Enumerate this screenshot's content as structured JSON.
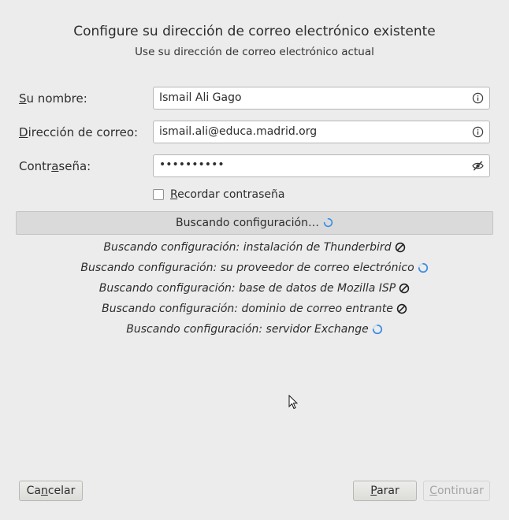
{
  "header": {
    "title": "Configure su dirección de correo electrónico existente",
    "subtitle": "Use su dirección de correo electrónico actual"
  },
  "form": {
    "name": {
      "label_pre": "",
      "label_key": "S",
      "label_post": "u nombre:",
      "value": "Ismail Ali Gago",
      "icon": "info-icon"
    },
    "email": {
      "label_pre": "",
      "label_key": "D",
      "label_post": "irección de correo:",
      "value": "ismail.ali@educa.madrid.org",
      "icon": "info-icon"
    },
    "password": {
      "label_pre": "Contr",
      "label_key": "a",
      "label_post": "seña:",
      "value": "••••••••••",
      "icon": "eye-slash-icon"
    },
    "remember": {
      "label_pre": "",
      "label_key": "R",
      "label_post": "ecordar contraseña",
      "checked": false
    }
  },
  "status": {
    "text": "Buscando configuración…",
    "icon": "spinner-icon"
  },
  "results": [
    {
      "text": "Buscando configuración: instalación de Thunderbird",
      "icon": "blocked-icon"
    },
    {
      "text": "Buscando configuración: su proveedor de correo electrónico",
      "icon": "spinner-icon"
    },
    {
      "text": "Buscando configuración: base de datos de Mozilla ISP",
      "icon": "blocked-icon"
    },
    {
      "text": "Buscando configuración: dominio de correo entrante",
      "icon": "blocked-icon"
    },
    {
      "text": "Buscando configuración: servidor Exchange",
      "icon": "spinner-icon"
    }
  ],
  "buttons": {
    "cancel": {
      "pre": "Ca",
      "key": "n",
      "post": "celar"
    },
    "stop": {
      "pre": "",
      "key": "P",
      "post": "arar"
    },
    "continue": {
      "pre": "",
      "key": "C",
      "post": "ontinuar",
      "enabled": false
    }
  },
  "colors": {
    "background": "#ececec",
    "spinner": "#3d8ee0",
    "disabled_text": "#a5a5a5"
  }
}
